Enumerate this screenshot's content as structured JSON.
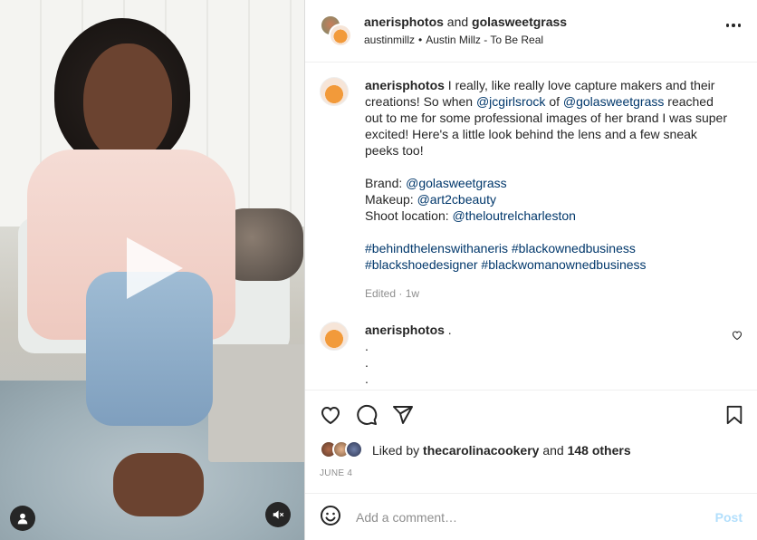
{
  "colors": {
    "link": "#00376b",
    "muted": "#8e8e8e",
    "post_disabled": "#b2dffc",
    "text": "#262626"
  },
  "header": {
    "user1": "anerisphotos",
    "joiner": "and",
    "user2": "golasweetgrass",
    "audio_user": "austinmillz",
    "separator": "•",
    "audio_track": "Austin Millz - To Be Real",
    "more_icon": "more-horizontal-icon"
  },
  "media": {
    "type": "video",
    "play_icon": "play-icon",
    "user_icon": "user-tag-icon",
    "mute_icon": "mute-icon"
  },
  "caption": {
    "username": "anerisphotos",
    "text1": "I really, like really love capture makers and their creations! So when",
    "mention1": "@jcgirlsrock",
    "of": "of",
    "mention2": "@golasweetgrass",
    "text2": "reached out to me for some professional images of her brand I was super excited! Here's a little look behind the lens and a few sneak peeks too!",
    "brand_label": "Brand:",
    "brand": "@golasweetgrass",
    "makeup_label": "Makeup:",
    "makeup": "@art2cbeauty",
    "location_label": "Shoot location:",
    "location": "@theloutrelcharleston",
    "tag1": "#behindthelenswithaneris",
    "tag2": "#blackownedbusiness",
    "tag3": "#blackshoedesigner",
    "tag4": "#blackwomanownedbusiness",
    "edited": "Edited",
    "time_sep": "·",
    "age": "1w"
  },
  "comment": {
    "username": "anerisphotos",
    "text": ".",
    "line2": ".",
    "line3": ".",
    "line4": ".",
    "like_icon": "heart-icon"
  },
  "actions": {
    "like_icon": "heart-icon",
    "comment_icon": "comment-icon",
    "share_icon": "send-icon",
    "save_icon": "bookmark-icon"
  },
  "likes": {
    "prefix": "Liked by",
    "user": "thecarolinacookery",
    "and": "and",
    "others": "148 others"
  },
  "date": "JUNE 4",
  "add_comment": {
    "emoji_icon": "emoji-icon",
    "placeholder": "Add a comment…",
    "post_label": "Post"
  }
}
